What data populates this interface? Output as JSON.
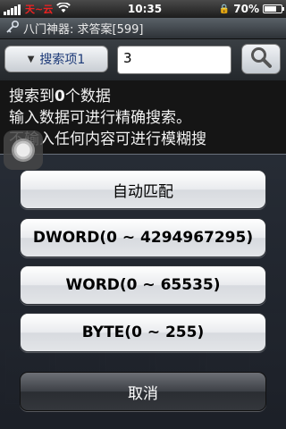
{
  "statusbar": {
    "carrier": "天~云",
    "time": "10:35",
    "battery": "70%",
    "battery_level": 0.7
  },
  "titlebar": {
    "title": "八门神器: 求答案[599]"
  },
  "search": {
    "item_label": "搜索项1",
    "input_value": "3"
  },
  "info": {
    "prefix": "搜索到",
    "count": "0",
    "suffix": "个数据",
    "line2": "输入数据可进行精确搜索。",
    "line3": "不输入任何内容可进行模糊搜"
  },
  "sheet": {
    "auto_label": "自动匹配",
    "dword_label": "DWORD(0 ~ 4294967295)",
    "word_label": "WORD(0 ~ 65535)",
    "byte_label": "BYTE(0 ~ 255)",
    "cancel_label": "取消"
  }
}
